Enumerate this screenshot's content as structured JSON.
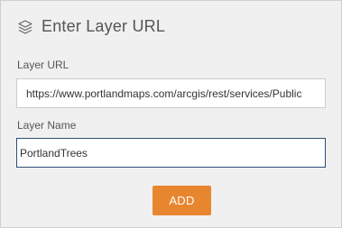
{
  "header": {
    "title": "Enter Layer URL",
    "icon": "layers-icon"
  },
  "form": {
    "url_label": "Layer URL",
    "url_value": "https://www.portlandmaps.com/arcgis/rest/services/Public",
    "name_label": "Layer Name",
    "name_value": "PortlandTrees"
  },
  "actions": {
    "add_label": "ADD",
    "add_color": "#e8862f"
  },
  "colors": {
    "panel_bg": "#f0f0f0",
    "active_border": "#2f4f77"
  }
}
